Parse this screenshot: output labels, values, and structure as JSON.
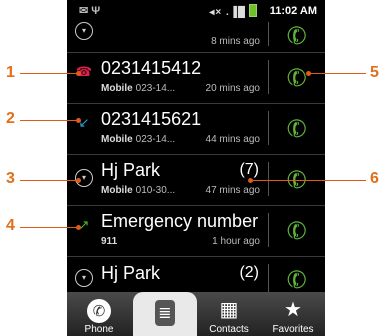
{
  "status_bar": {
    "time": "11:02 AM",
    "signal": "◂× .▐█",
    "left_icons": "✉ Ψ"
  },
  "top_partial": {
    "ago": "8 mins ago"
  },
  "calls": [
    {
      "name": "0231415412",
      "type": "Mobile",
      "number": "023-14...",
      "ago": "20 mins ago",
      "count": "",
      "type_icon": "missed-call-icon",
      "color": "#e0204b"
    },
    {
      "name": "0231415621",
      "type": "Mobile",
      "number": "023-14...",
      "ago": "44 mins ago",
      "count": "",
      "type_icon": "incoming-call-icon",
      "color": "#2aa6e0"
    },
    {
      "name": "Hj Park",
      "type": "Mobile",
      "number": "010-30...",
      "ago": "47 mins ago",
      "count": "(7)",
      "type_icon": "expand-group-icon",
      "color": "#cccccc"
    },
    {
      "name": "Emergency number",
      "type": "911",
      "number": "",
      "ago": "1 hour ago",
      "count": "",
      "type_icon": "outgoing-call-icon",
      "color": "#4dbb2a"
    },
    {
      "name": "Hj Park",
      "type": "",
      "number": "",
      "ago": "",
      "count": "(2)",
      "type_icon": "expand-group-icon",
      "color": "#cccccc"
    }
  ],
  "tabs": [
    {
      "label": "Phone",
      "icon": "phone-icon"
    },
    {
      "label": "",
      "icon": "call-log-icon"
    },
    {
      "label": "Contacts",
      "icon": "contacts-icon"
    },
    {
      "label": "Favorites",
      "icon": "star-icon"
    }
  ],
  "callouts": [
    "1",
    "2",
    "3",
    "4",
    "5",
    "6"
  ],
  "colors": {
    "accent_callout": "#e05a1a",
    "call_green": "#5fb43c"
  }
}
